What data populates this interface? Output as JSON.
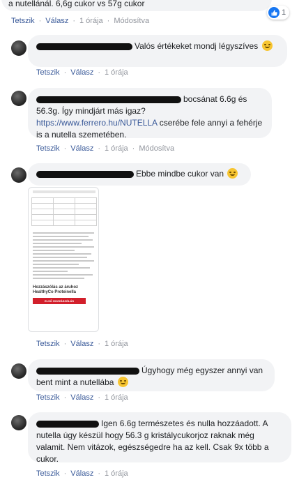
{
  "top_comment": {
    "text": "a nutellánál. 6,6g cukor vs 57g cukor",
    "actions": {
      "like": "Tetszik",
      "reply": "Válasz",
      "time": "1 órája",
      "edited": "Módosítva"
    },
    "reaction_count": "1",
    "reaction_icon": "like-icon"
  },
  "comments": [
    {
      "text": "Valós értékeket mondj légyszíves",
      "emoji": "smile-icon",
      "actions": {
        "like": "Tetszik",
        "reply": "Válasz",
        "time": "1 órája"
      }
    },
    {
      "text_part1": "bocsánat 6.6g és 56.3g. Így mindjárt más igaz? ",
      "link": "https://www.ferrero.hu/NUTELLA",
      "text_part2": " cserébe fele annyi a fehérje is a nutella szemetében.",
      "actions": {
        "like": "Tetszik",
        "reply": "Válasz",
        "time": "1 órája",
        "edited": "Módosítva"
      }
    },
    {
      "text": "Ebbe mindbe cukor van",
      "emoji": "smile-icon",
      "photo": {
        "product_title": "Hozzászólás az áruhoz HealthyCo Proteinella",
        "button_label": "ELSŐ HOZZÁSZÓLÁS MEGJELENTETÉS"
      },
      "actions": {
        "like": "Tetszik",
        "reply": "Válasz",
        "time": "1 órája"
      }
    },
    {
      "text": "Úgyhogy még egyszer annyi van bent mint a nutellába",
      "emoji": "smile-icon",
      "actions": {
        "like": "Tetszik",
        "reply": "Válasz",
        "time": "1 órája"
      }
    },
    {
      "text": "Igen 6.6g természetes és nulla hozzáadott. A nutella úgy készül hogy 56.3 g kristálycukorjoz raknak még valamit. Nem vitázok, egészségedre ha az kell. Csak 9x több a cukor.",
      "actions": {
        "like": "Tetszik",
        "reply": "Válasz",
        "time": "1 órája"
      }
    }
  ]
}
